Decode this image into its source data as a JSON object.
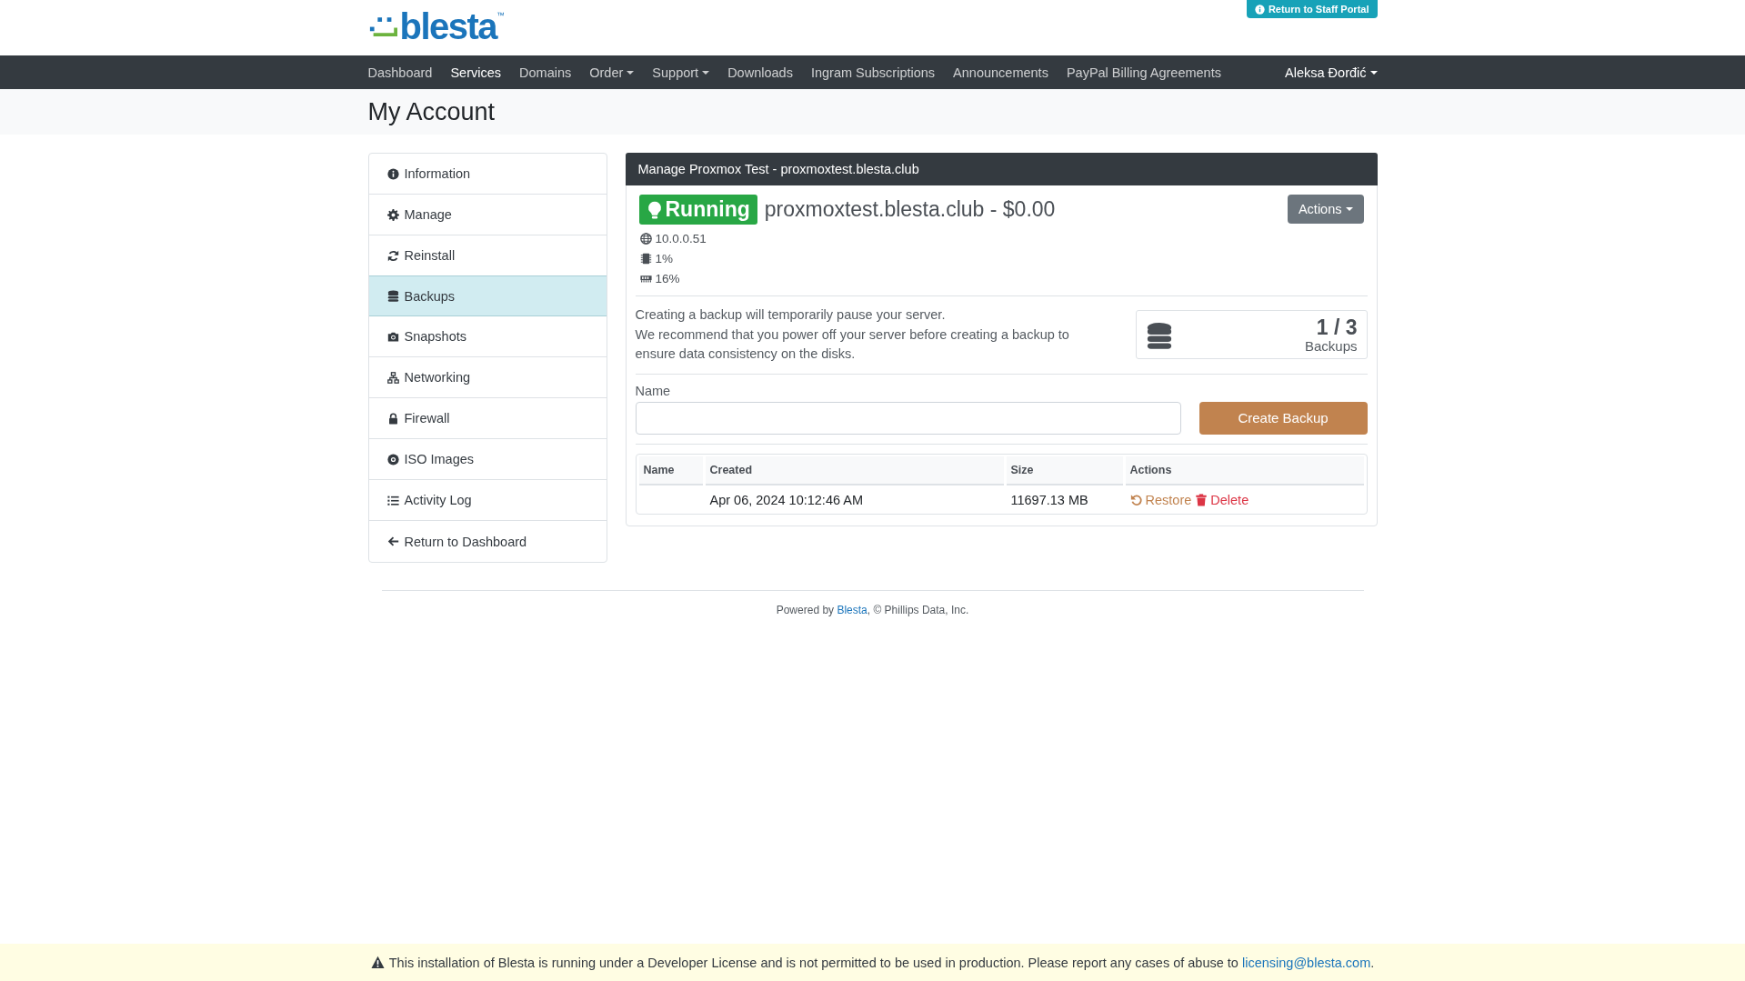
{
  "header": {
    "logo_text": "blesta",
    "logo_mark": "™",
    "staff_button": "Return to Staff Portal"
  },
  "nav": {
    "items": [
      {
        "label": "Dashboard",
        "selected": false,
        "dropdown": false
      },
      {
        "label": "Services",
        "selected": true,
        "dropdown": false
      },
      {
        "label": "Domains",
        "selected": false,
        "dropdown": false
      },
      {
        "label": "Order",
        "selected": false,
        "dropdown": true
      },
      {
        "label": "Support",
        "selected": false,
        "dropdown": true
      },
      {
        "label": "Downloads",
        "selected": false,
        "dropdown": false
      },
      {
        "label": "Ingram Subscriptions",
        "selected": false,
        "dropdown": false
      },
      {
        "label": "Announcements",
        "selected": false,
        "dropdown": false
      },
      {
        "label": "PayPal Billing Agreements",
        "selected": false,
        "dropdown": false
      }
    ],
    "user": "Aleksa Đorđić"
  },
  "page_title": "My Account",
  "sidebar": {
    "items": [
      {
        "kind": "info",
        "label": "Information",
        "selected": false
      },
      {
        "kind": "gear",
        "label": "Manage",
        "selected": false
      },
      {
        "kind": "sync",
        "label": "Reinstall",
        "selected": false
      },
      {
        "kind": "database",
        "label": "Backups",
        "selected": true
      },
      {
        "kind": "camera",
        "label": "Snapshots",
        "selected": false
      },
      {
        "kind": "network",
        "label": "Networking",
        "selected": false
      },
      {
        "kind": "lock",
        "label": "Firewall",
        "selected": false
      },
      {
        "kind": "disc",
        "label": "ISO Images",
        "selected": false
      },
      {
        "kind": "list",
        "label": "Activity Log",
        "selected": false
      },
      {
        "kind": "back",
        "label": "Return to Dashboard",
        "selected": false
      }
    ]
  },
  "service": {
    "header": "Manage Proxmox Test - proxmoxtest.blesta.club",
    "status": "Running",
    "title": "proxmoxtest.blesta.club - $0.00",
    "actions_button": "Actions",
    "stats": [
      {
        "kind": "ip",
        "text": "10.0.0.51"
      },
      {
        "kind": "cpu",
        "text": "1%"
      },
      {
        "kind": "memory",
        "text": "16%"
      }
    ],
    "notice": [
      "Creating a backup will temporarily pause your server.",
      "We recommend that you power off your server before creating a backup to ensure data consistency on the disks."
    ],
    "backup_count": "1 / 3",
    "backup_count_label": "Backups",
    "form": {
      "label": "Name",
      "button": "Create Backup"
    },
    "table": {
      "columns": [
        "Name",
        "Created",
        "Size",
        "Actions"
      ],
      "rows": [
        {
          "created": "Apr 06, 2024 10:12:46 AM",
          "size": "11697.13 MB",
          "actions": [
            {
              "kind": "restore",
              "label": "Restore"
            },
            {
              "kind": "delete",
              "label": "Delete"
            }
          ]
        }
      ]
    }
  },
  "footer": {
    "before": "Powered by",
    "link": "Blesta",
    "after": ", © Phillips Data, Inc."
  },
  "license": {
    "text": "This installation of Blesta is running under a Developer License and is not permitted to be used in production. Please report any cases of abuse to",
    "link": "licensing@blesta.com",
    "after": "."
  }
}
